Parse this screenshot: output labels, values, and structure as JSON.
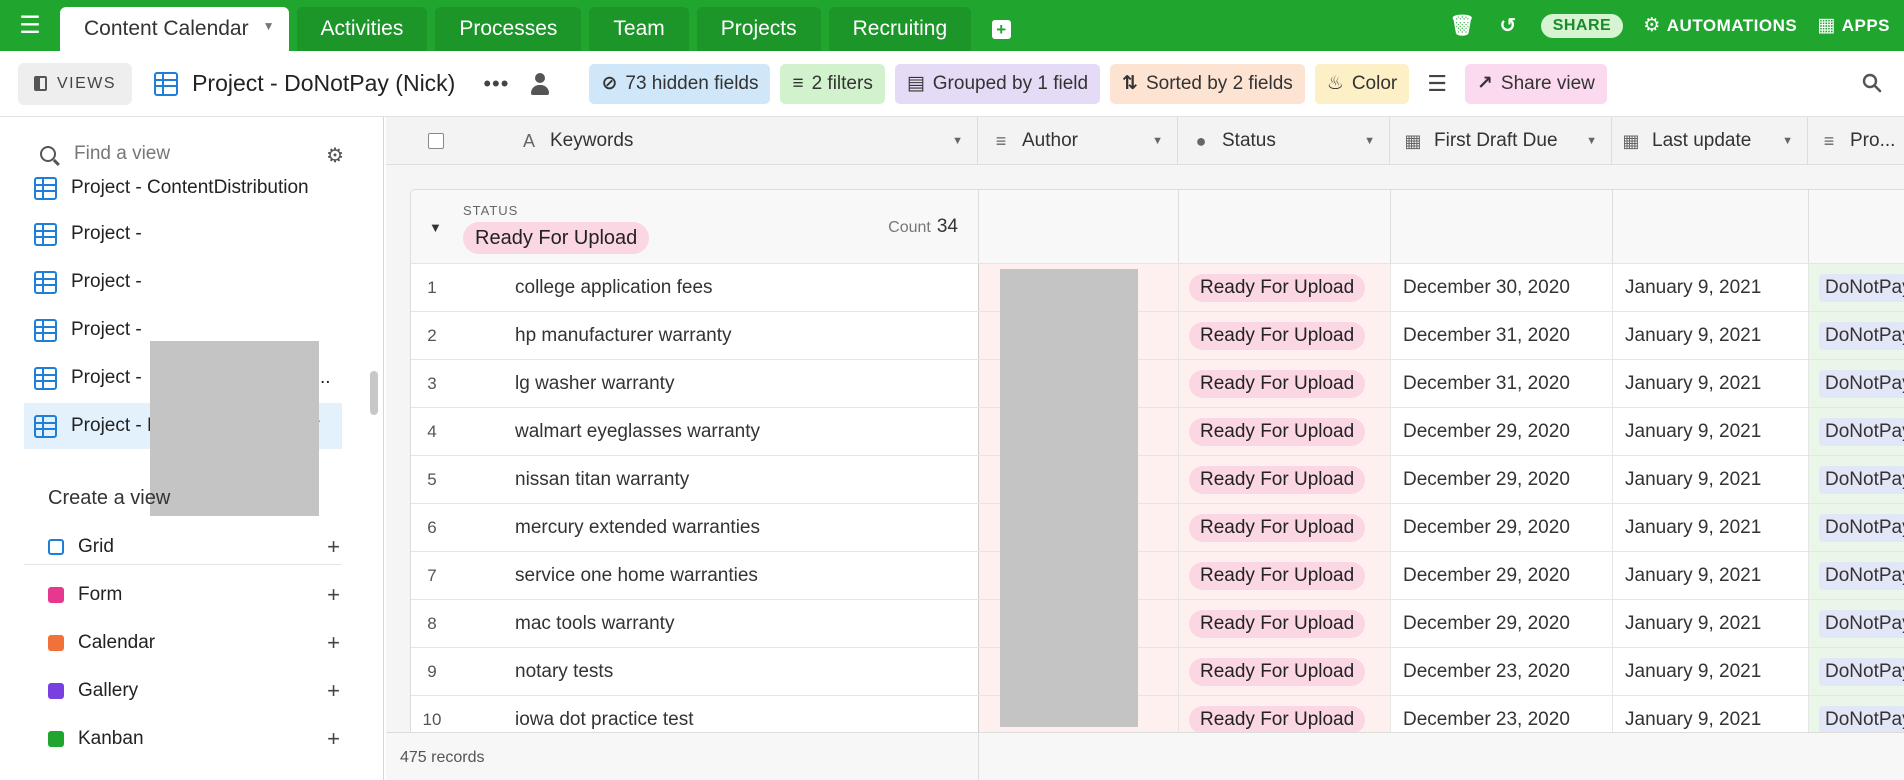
{
  "topbar": {
    "tabs": [
      "Content Calendar",
      "Activities",
      "Processes",
      "Team",
      "Projects",
      "Recruiting"
    ],
    "share_label": "SHARE",
    "automations_label": "AUTOMATIONS",
    "apps_label": "APPS"
  },
  "viewbar": {
    "views_label": "VIEWS",
    "view_name": "Project - DoNotPay (Nick)",
    "hidden_fields": "73 hidden fields",
    "filters": "2 filters",
    "grouped": "Grouped by 1 field",
    "sorted": "Sorted by 2 fields",
    "color": "Color",
    "share_view": "Share view"
  },
  "sidebar": {
    "find_placeholder": "Find a view",
    "views": [
      "Project - ContentDistribution",
      "Project -",
      "Project -",
      "Project -",
      "Project -",
      "Project - DoNotPa..."
    ],
    "partial_suffix": "..",
    "create_title": "Create a view",
    "create_items": [
      {
        "label": "Grid",
        "color": "#1f7fd6"
      },
      {
        "label": "Form",
        "color": "#e8378f"
      },
      {
        "label": "Calendar",
        "color": "#f0723a"
      },
      {
        "label": "Gallery",
        "color": "#7a3fe0"
      },
      {
        "label": "Kanban",
        "color": "#20a52f"
      }
    ]
  },
  "grid": {
    "columns": [
      "Keywords",
      "Author",
      "Status",
      "First Draft Due",
      "Last update",
      "Pro..."
    ],
    "group": {
      "label": "STATUS",
      "value": "Ready For Upload",
      "count_label": "Count",
      "count": "34"
    },
    "rows": [
      {
        "n": "1",
        "keyword": "college application fees",
        "status": "Ready For Upload",
        "draft_due": "December 30, 2020",
        "last_update": "January 9, 2021",
        "project": "DoNotPay"
      },
      {
        "n": "2",
        "keyword": "hp manufacturer warranty",
        "status": "Ready For Upload",
        "draft_due": "December 31, 2020",
        "last_update": "January 9, 2021",
        "project": "DoNotPay"
      },
      {
        "n": "3",
        "keyword": "lg washer warranty",
        "status": "Ready For Upload",
        "draft_due": "December 31, 2020",
        "last_update": "January 9, 2021",
        "project": "DoNotPay"
      },
      {
        "n": "4",
        "keyword": "walmart eyeglasses warranty",
        "status": "Ready For Upload",
        "draft_due": "December 29, 2020",
        "last_update": "January 9, 2021",
        "project": "DoNotPay"
      },
      {
        "n": "5",
        "keyword": "nissan titan warranty",
        "status": "Ready For Upload",
        "draft_due": "December 29, 2020",
        "last_update": "January 9, 2021",
        "project": "DoNotPay"
      },
      {
        "n": "6",
        "keyword": "mercury extended warranties",
        "status": "Ready For Upload",
        "draft_due": "December 29, 2020",
        "last_update": "January 9, 2021",
        "project": "DoNotPay"
      },
      {
        "n": "7",
        "keyword": "service one home warranties",
        "status": "Ready For Upload",
        "draft_due": "December 29, 2020",
        "last_update": "January 9, 2021",
        "project": "DoNotPay"
      },
      {
        "n": "8",
        "keyword": "mac tools warranty",
        "status": "Ready For Upload",
        "draft_due": "December 29, 2020",
        "last_update": "January 9, 2021",
        "project": "DoNotPay"
      },
      {
        "n": "9",
        "keyword": "notary tests",
        "status": "Ready For Upload",
        "draft_due": "December 23, 2020",
        "last_update": "January 9, 2021",
        "project": "DoNotPay"
      },
      {
        "n": "10",
        "keyword": "iowa dot practice test",
        "status": "Ready For Upload",
        "draft_due": "December 23, 2020",
        "last_update": "January 9, 2021",
        "project": "DoNotPay"
      }
    ],
    "footer_records": "475 records"
  }
}
